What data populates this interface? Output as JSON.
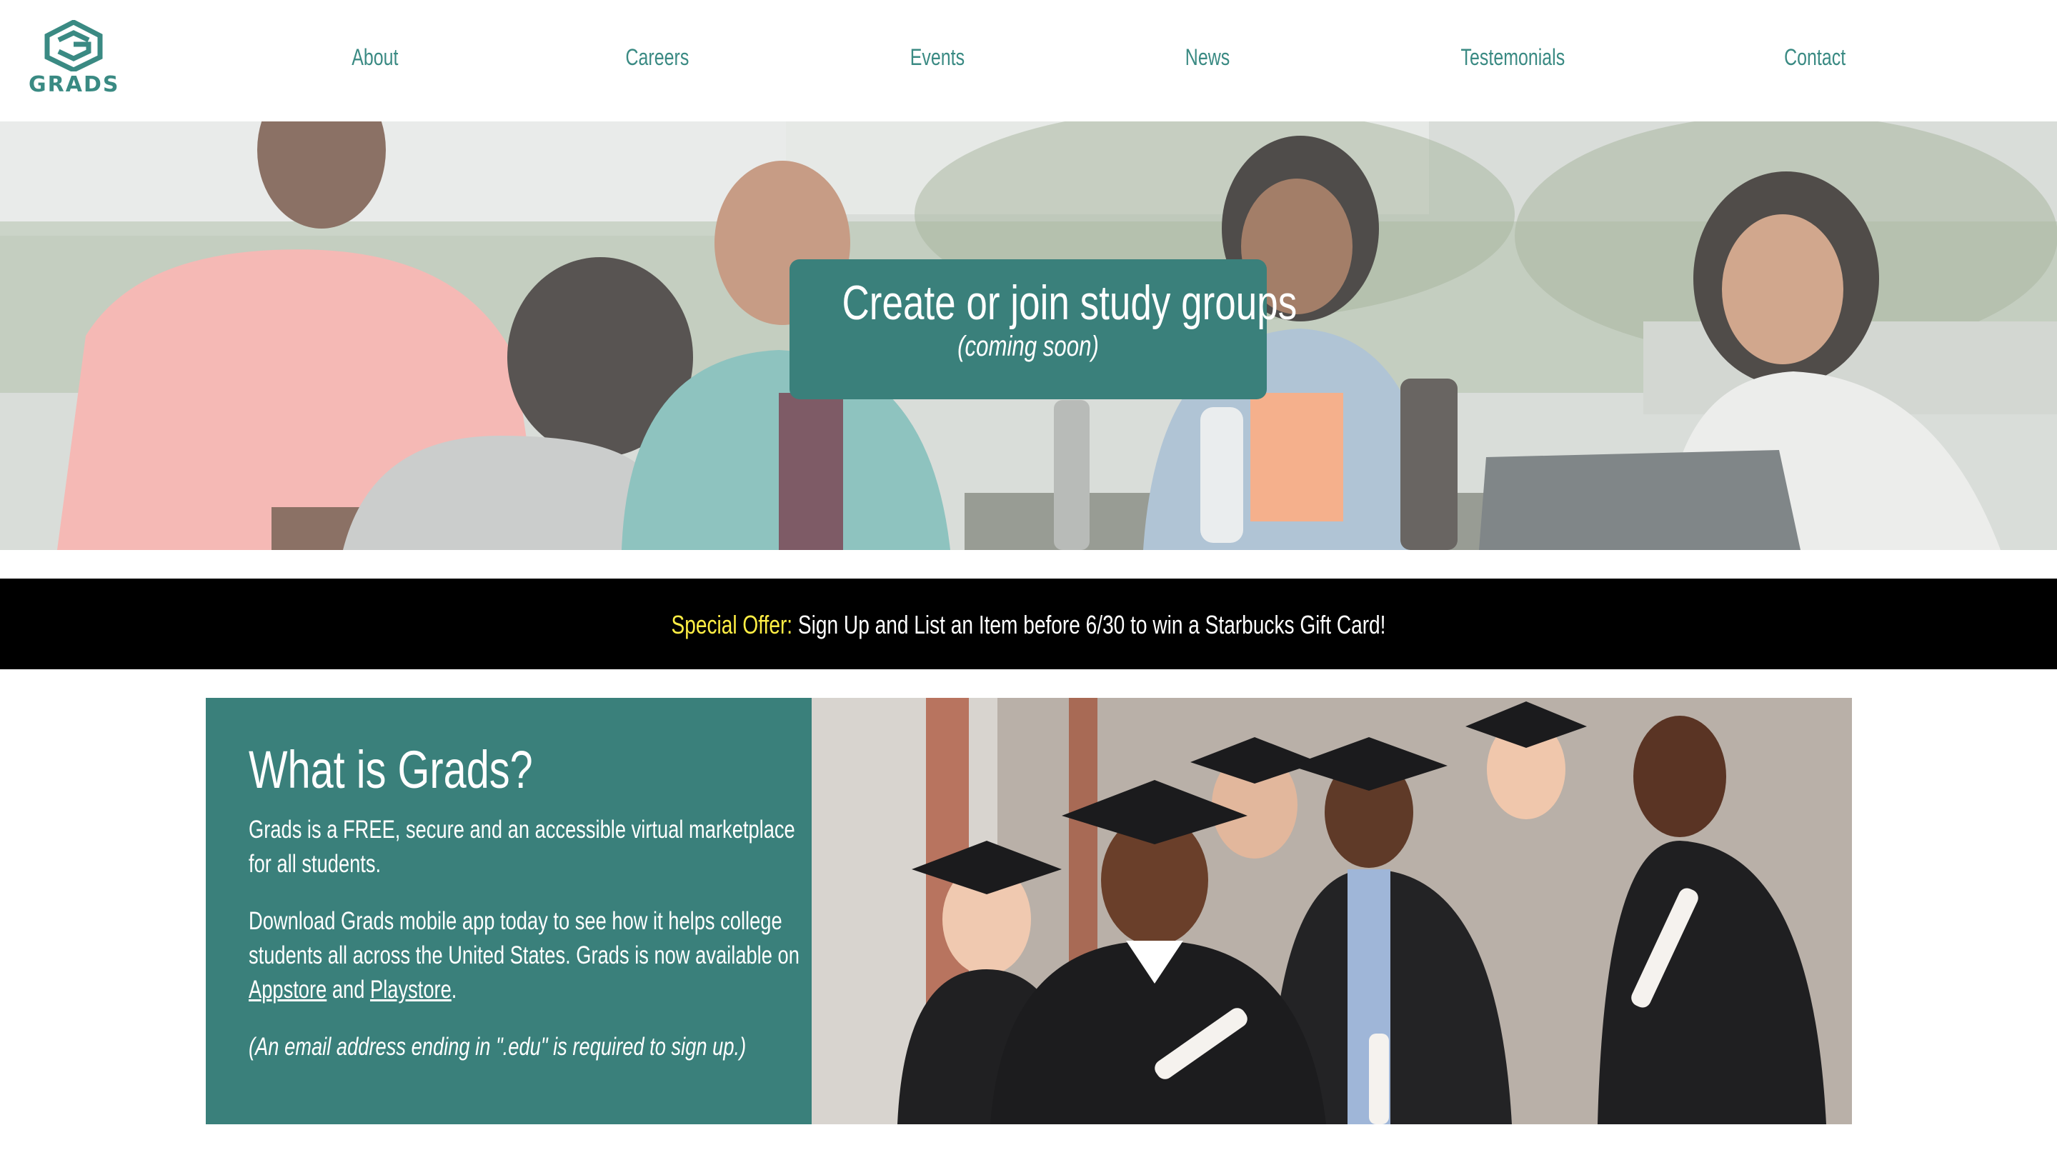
{
  "brand": {
    "name": "GRADS",
    "color": "#3a8a83",
    "accent": "#3a807b"
  },
  "nav": {
    "items": [
      {
        "label": "About"
      },
      {
        "label": "Careers"
      },
      {
        "label": "Events"
      },
      {
        "label": "News"
      },
      {
        "label": "Testemonials"
      },
      {
        "label": "Contact"
      }
    ]
  },
  "hero": {
    "title": "Create or join study groups",
    "subtitle": "(coming soon)"
  },
  "offer": {
    "label": "Special Offer:",
    "text": "Sign Up and List an Item before 6/30 to win a Starbucks Gift Card!",
    "label_color": "#ffee44"
  },
  "about": {
    "title": "What is Grads?",
    "p1": "Grads is a FREE, secure and an accessible virtual marketplace for all students.",
    "p2_lead": "Download Grads mobile app today to see how it helps college students all across the United States. Grads is now available on ",
    "appstore": "Appstore",
    "and": " and ",
    "playstore": "Playstore",
    "period": ".",
    "note": "(An email address ending in \".edu\" is required to sign up.)"
  },
  "icons": {
    "logo": "grads-hexagon-logo-icon"
  }
}
